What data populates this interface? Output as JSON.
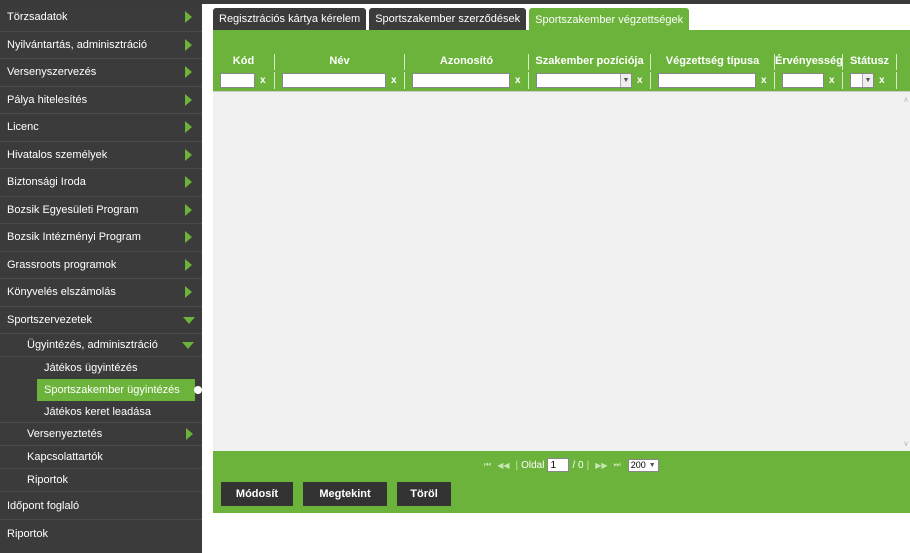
{
  "sidebar": {
    "items": [
      {
        "label": "Törzsadatok"
      },
      {
        "label": "Nyilvántartás, adminisztráció"
      },
      {
        "label": "Versenyszervezés"
      },
      {
        "label": "Pálya hitelesítés"
      },
      {
        "label": "Licenc"
      },
      {
        "label": "Hivatalos személyek"
      },
      {
        "label": "Biztonsági Iroda"
      },
      {
        "label": "Bozsik Egyesületi Program"
      },
      {
        "label": "Bozsik Intézményi Program"
      },
      {
        "label": "Grassroots programok"
      },
      {
        "label": "Könyvelés elszámolás"
      },
      {
        "label": "Sportszervezetek"
      }
    ],
    "sub": {
      "ugyintezes": "Ügyintézés, adminisztráció",
      "jatekos_ugyintezes": "Játékos ügyintézés",
      "sportszakember_ugyintezes": "Sportszakember ügyintézés",
      "jatekos_keret": "Játékos keret leadása",
      "versenyeztetes": "Versenyeztetés",
      "kapcsolattartok": "Kapcsolattartók",
      "riportok": "Riportok"
    },
    "bottom": {
      "idopont": "Időpont foglaló",
      "riportok": "Riportok"
    }
  },
  "tabs": [
    {
      "label": "Regisztrációs kártya kérelem"
    },
    {
      "label": "Sportszakember szerződések"
    },
    {
      "label": "Sportszakember végzettségek"
    }
  ],
  "grid": {
    "columns": [
      "Kód",
      "Név",
      "Azonosító",
      "Szakember pozíciója",
      "Végzettség típusa",
      "Érvényesség",
      "Státusz"
    ],
    "clear_label": "x"
  },
  "pager": {
    "first": "⏮",
    "prev": "◀◀",
    "page_label": "Oldal",
    "page_value": "1",
    "of_label": "/ 0",
    "next": "▶▶",
    "last": "⏭",
    "page_size": "200"
  },
  "actions": {
    "modify": "Módosít",
    "view": "Megtekint",
    "delete": "Töröl"
  },
  "colors": {
    "accent": "#6bb33a",
    "sidebar": "#3b3b3b"
  }
}
